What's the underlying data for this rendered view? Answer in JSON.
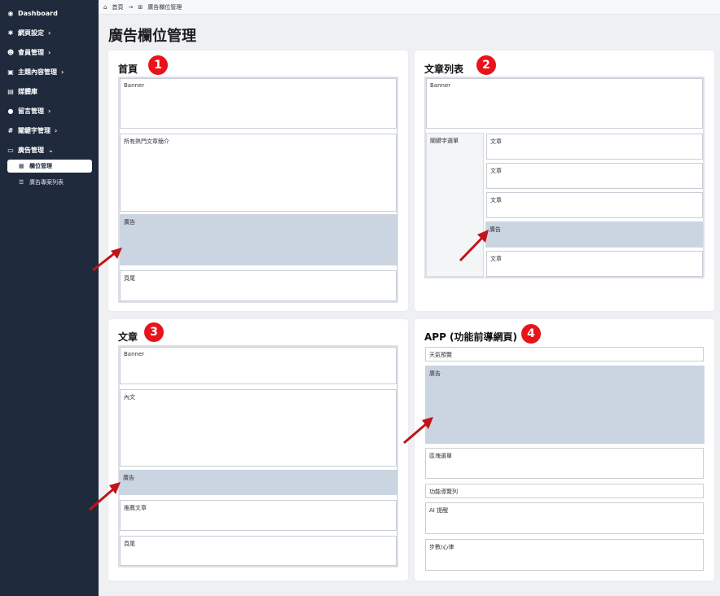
{
  "sidebar": {
    "items": [
      {
        "label": "Dashboard",
        "icon": "dashboard-icon",
        "glyph": "◉",
        "chevron": ""
      },
      {
        "label": "網頁設定",
        "icon": "gear-icon",
        "glyph": "✱",
        "chevron": "›"
      },
      {
        "label": "會員管理",
        "icon": "users-icon",
        "glyph": "☻",
        "chevron": "›"
      },
      {
        "label": "主題內容管理",
        "icon": "book-icon",
        "glyph": "▣",
        "chevron": "›"
      },
      {
        "label": "媒體庫",
        "icon": "media-icon",
        "glyph": "▤",
        "chevron": ""
      },
      {
        "label": "留言管理",
        "icon": "comment-icon",
        "glyph": "●",
        "chevron": "›"
      },
      {
        "label": "關鍵字管理",
        "icon": "hash-icon",
        "glyph": "#",
        "chevron": "›"
      },
      {
        "label": "廣告管理",
        "icon": "ad-icon",
        "glyph": "▭",
        "chevron": "⌄"
      }
    ],
    "subitems": [
      {
        "label": "欄位管理",
        "icon": "layout-icon",
        "glyph": "▦"
      },
      {
        "label": "廣告專案列表",
        "icon": "list-icon",
        "glyph": "☰"
      }
    ]
  },
  "breadcrumb": {
    "home": "首頁",
    "current": "廣告欄位管理",
    "home_glyph": "⌂",
    "sep_glyph": "→",
    "current_glyph": "⊞"
  },
  "page": {
    "title": "廣告欄位管理"
  },
  "cards": {
    "home": {
      "title": "首頁",
      "badge": "1",
      "slots": {
        "banner": "Banner",
        "hot": "所有熱門文章簡介",
        "ad": "廣告",
        "footer": "頁尾"
      }
    },
    "list": {
      "title": "文章列表",
      "badge": "2",
      "slots": {
        "banner": "Banner",
        "keyword": "關鍵字選單",
        "a1": "文章",
        "a2": "文章",
        "a3": "文章",
        "ad": "廣告",
        "a4": "文章"
      }
    },
    "article": {
      "title": "文章",
      "badge": "3",
      "slots": {
        "banner": "Banner",
        "content": "內文",
        "ad": "廣告",
        "recommend": "推薦文章",
        "footer": "頁尾"
      }
    },
    "app": {
      "title": "APP (功能前導網頁)",
      "badge": "4",
      "slots": {
        "weather": "天氣預覽",
        "ad": "廣告",
        "region": "區塊選單",
        "nav": "功能導覽列",
        "ai": "AI 提醒",
        "steps": "步數/心律"
      }
    }
  },
  "colors": {
    "sidebar": "#1f2a3c",
    "badge": "#e8141b",
    "ad_slot": "#cbd5e1",
    "arrow": "#c0141a"
  }
}
